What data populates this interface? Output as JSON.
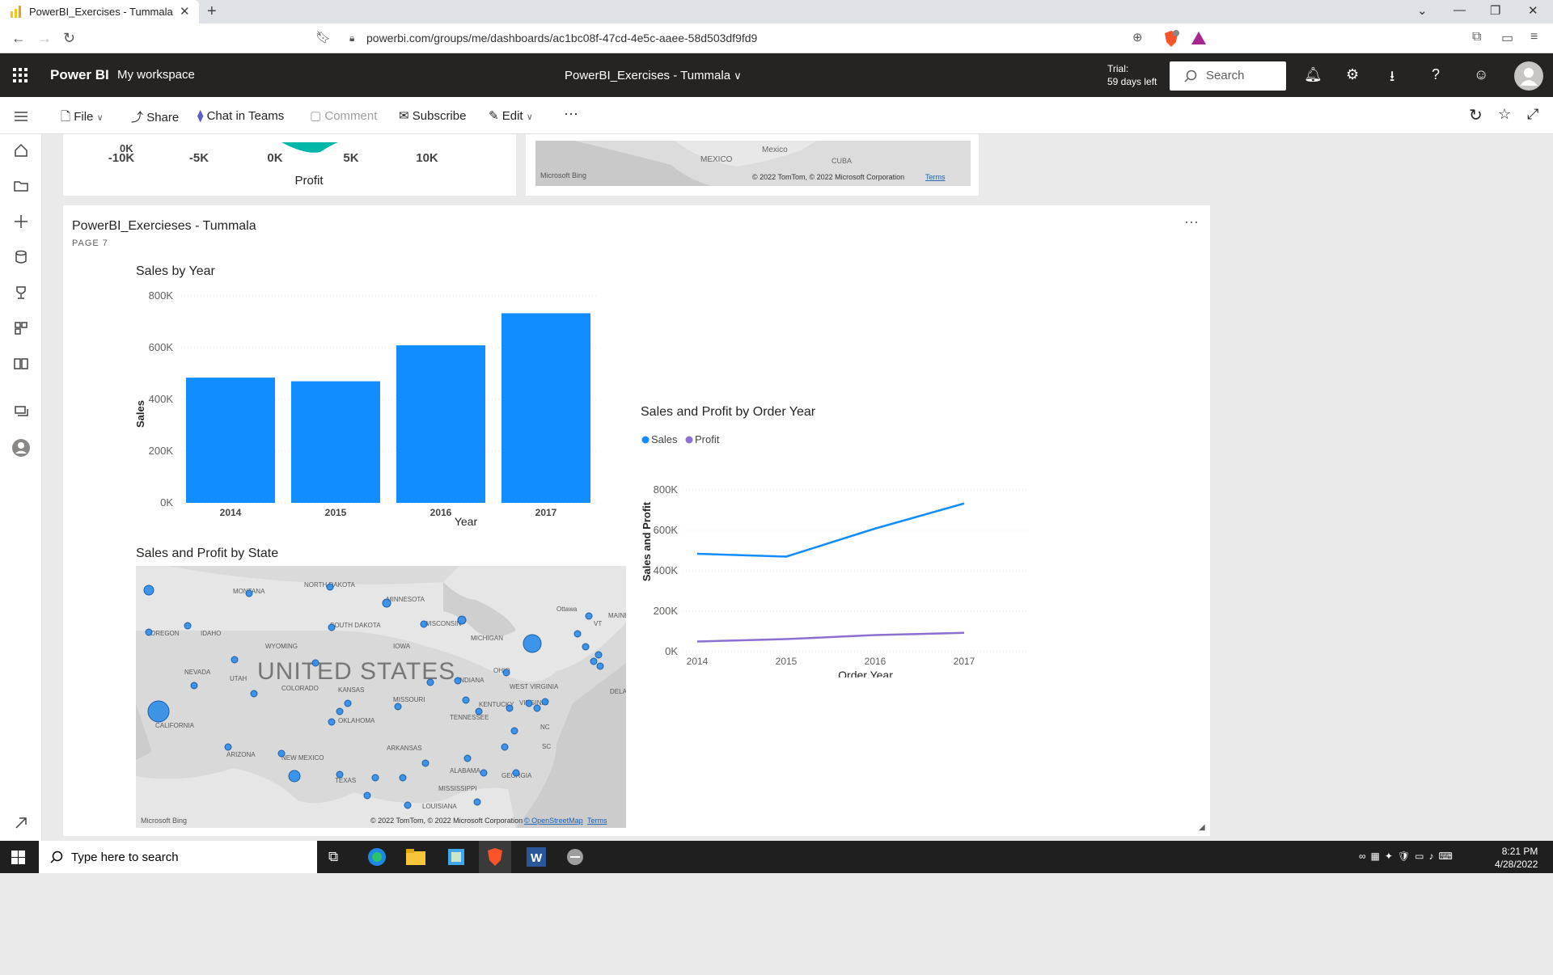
{
  "browser": {
    "tab_title": "PowerBI_Exercises - Tummala - Pc",
    "url": "powerbi.com/groups/me/dashboards/ac1bc08f-47cd-4e5c-aaee-58d503df9fd9"
  },
  "header": {
    "brand": "Power BI",
    "workspace": "My workspace",
    "report_title": "PowerBI_Exercises - Tummala",
    "trial_line1": "Trial:",
    "trial_line2": "59 days left",
    "search_placeholder": "Search"
  },
  "actionbar": {
    "file": "File",
    "share": "Share",
    "chat": "Chat in Teams",
    "comment": "Comment",
    "subscribe": "Subscribe",
    "edit": "Edit"
  },
  "top_tile": {
    "zero_label": "0K",
    "x_ticks": [
      "-10K",
      "-5K",
      "0K",
      "5K",
      "10K"
    ],
    "x_title": "Profit",
    "map_labels": [
      "Mexico",
      "MEXICO",
      "CUBA"
    ],
    "map_copyright": "© 2022 TomTom, © 2022 Microsoft Corporation",
    "map_terms": "Terms",
    "bing": "Microsoft Bing"
  },
  "report_tile": {
    "title": "PowerBI_Exercieses - Tummala",
    "page": "PAGE 7",
    "more": "···"
  },
  "map_state": {
    "title": "Sales and Profit by State",
    "country_label": "UNITED STATES",
    "labels": [
      "MONTANA",
      "NORTH DAKOTA",
      "MINNESOTA",
      "SOUTH DAKOTA",
      "WISCONSIN",
      "MICHIGAN",
      "OREGON",
      "IDAHO",
      "WYOMING",
      "IOWA",
      "NEVADA",
      "UTAH",
      "COLORADO",
      "KANSAS",
      "MISSOURI",
      "INDIANA",
      "OHIO",
      "CALIFORNIA",
      "KENTUCKY",
      "WEST VIRGINIA",
      "VIRGINIA",
      "OKLAHOMA",
      "TENNESSEE",
      "ARIZONA",
      "NEW MEXICO",
      "ARKANSAS",
      "ALABAMA",
      "GEORGIA",
      "MISSISSIPPI",
      "TEXAS",
      "LOUISIANA",
      "Ottawa",
      "VT",
      "MAINE",
      "DELAWARE",
      "NC",
      "SC"
    ],
    "copyright": "© 2022 TomTom, © 2022 Microsoft Corporation",
    "osm": "© OpenStreetMap",
    "terms": "Terms",
    "bing": "Microsoft Bing"
  },
  "chart_data": [
    {
      "type": "bar",
      "title": "Sales by Year",
      "categories": [
        "2014",
        "2015",
        "2016",
        "2017"
      ],
      "values": [
        484000,
        470000,
        609000,
        733000
      ],
      "xlabel": "Year",
      "ylabel": "Sales",
      "ylim": [
        0,
        800000
      ],
      "yticks": [
        "0K",
        "200K",
        "400K",
        "600K",
        "800K"
      ],
      "color": "#118dff"
    },
    {
      "type": "line",
      "title": "Sales and Profit by Order Year",
      "categories": [
        "2014",
        "2015",
        "2016",
        "2017"
      ],
      "series": [
        {
          "name": "Sales",
          "values": [
            484000,
            470000,
            609000,
            733000
          ],
          "color": "#118dff"
        },
        {
          "name": "Profit",
          "values": [
            50000,
            62000,
            82000,
            93000
          ],
          "color": "#8c6fd1"
        }
      ],
      "xlabel": "Order Year",
      "ylabel": "Sales and Profit",
      "ylim": [
        0,
        800000
      ],
      "yticks": [
        "0K",
        "200K",
        "400K",
        "600K",
        "800K"
      ],
      "legend": "top-left"
    }
  ],
  "taskbar": {
    "search": "Type here to search",
    "time": "8:21 PM",
    "date": "4/28/2022"
  }
}
